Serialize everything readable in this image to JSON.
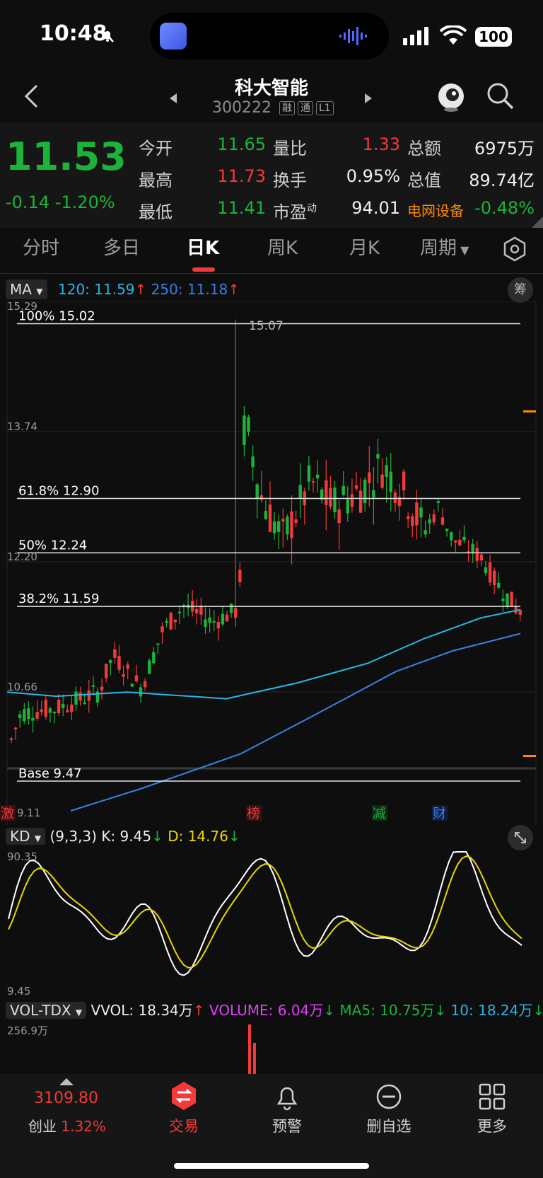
{
  "status": {
    "time": "10:48",
    "battery": "100"
  },
  "header": {
    "title": "科大智能",
    "code": "300222",
    "tags": [
      "融",
      "通",
      "L1"
    ]
  },
  "quote": {
    "price": "11.53",
    "change": "-0.14",
    "change_pct": "-1.20%",
    "fields": [
      {
        "label": "今开",
        "value": "11.65",
        "color": "green"
      },
      {
        "label": "量比",
        "value": "1.33",
        "color": "red"
      },
      {
        "label": "总额",
        "value": "6975万",
        "color": "white"
      },
      {
        "label": "最高",
        "value": "11.73",
        "color": "red"
      },
      {
        "label": "换手",
        "value": "0.95%",
        "color": "white"
      },
      {
        "label": "总值",
        "value": "89.74亿",
        "color": "white"
      },
      {
        "label": "最低",
        "value": "11.41",
        "color": "green"
      },
      {
        "label": "市盈",
        "label_sup": "动",
        "value": "94.01",
        "color": "white"
      },
      {
        "label": "电网设备",
        "value": "-0.48%",
        "color": "green"
      }
    ]
  },
  "tabs": [
    "分时",
    "多日",
    "日K",
    "周K",
    "月K",
    "周期"
  ],
  "active_tab": "日K",
  "ma_row": {
    "selector": "MA",
    "ma120": "120: 11.59",
    "ma250": "250: 11.18",
    "chip": "筹"
  },
  "kline": {
    "axis_labels": [
      "15.29",
      "13.74",
      "12.20",
      "10.66",
      "9.11"
    ],
    "fib_lines": [
      {
        "label": "100% 15.02",
        "value": 15.02
      },
      {
        "label": "61.8% 12.90",
        "value": 12.9
      },
      {
        "label": "50% 12.24",
        "value": 12.24
      },
      {
        "label": "38.2% 11.59",
        "value": 11.59
      },
      {
        "label": "Base 9.47",
        "value": 9.47
      }
    ],
    "high_mark": "15.07",
    "event_markers": [
      {
        "text": "激",
        "color": "#f23a3a"
      },
      {
        "text": "榜",
        "color": "#f23a3a"
      },
      {
        "text": "减",
        "color": "#1db33a"
      },
      {
        "text": "财",
        "color": "#3b82f6"
      }
    ],
    "colors": {
      "up": "#f23a3a",
      "down": "#1db33a",
      "ma120": "#2bb5e6",
      "ma250": "#3a80e6"
    }
  },
  "kd": {
    "selector": "KD",
    "params": "(9,3,3)",
    "k": "K: 9.45",
    "d": "D: 14.76",
    "top": "90.35",
    "bottom": "9.45"
  },
  "vol": {
    "selector": "VOL-TDX",
    "vvol": "VVOL: 18.34万",
    "volume": "VOLUME: 6.04万",
    "ma5": "MA5: 10.75万",
    "ma10": "10: 18.24万",
    "top": "256.9万"
  },
  "bottom_nav": {
    "index_value": "3109.80",
    "index_name": "创业",
    "index_pct": "1.32%",
    "items": [
      "交易",
      "预警",
      "删自选",
      "更多"
    ]
  }
}
